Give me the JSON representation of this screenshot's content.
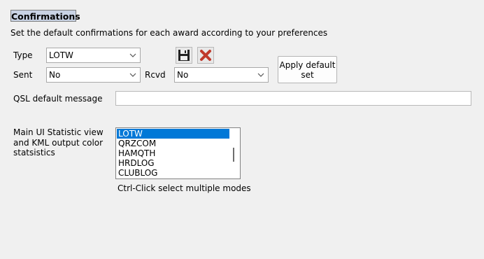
{
  "section": {
    "title": "Confirmations"
  },
  "description": "Set the default confirmations for each award according to your preferences",
  "type": {
    "label": "Type",
    "value": "LOTW"
  },
  "sent": {
    "label": "Sent",
    "value": "No"
  },
  "rcvd": {
    "label": "Rcvd",
    "value": "No"
  },
  "toolbar": {
    "save_icon": "floppy-disk-icon",
    "delete_icon": "red-x-icon"
  },
  "apply_button": {
    "label": "Apply default set"
  },
  "qsl": {
    "label": "QSL default message",
    "value": ""
  },
  "statistics": {
    "label": "Main UI Statistic view and KML output color statsistics",
    "items": [
      "LOTW",
      "QRZCOM",
      "HAMQTH",
      "HRDLOG",
      "CLUBLOG"
    ],
    "selected": "LOTW",
    "hint": "Ctrl-Click select multiple modes"
  },
  "colors": {
    "selection": "#0078d7",
    "header_bg": "#c9d3e4",
    "delete_icon": "#c0392b"
  }
}
